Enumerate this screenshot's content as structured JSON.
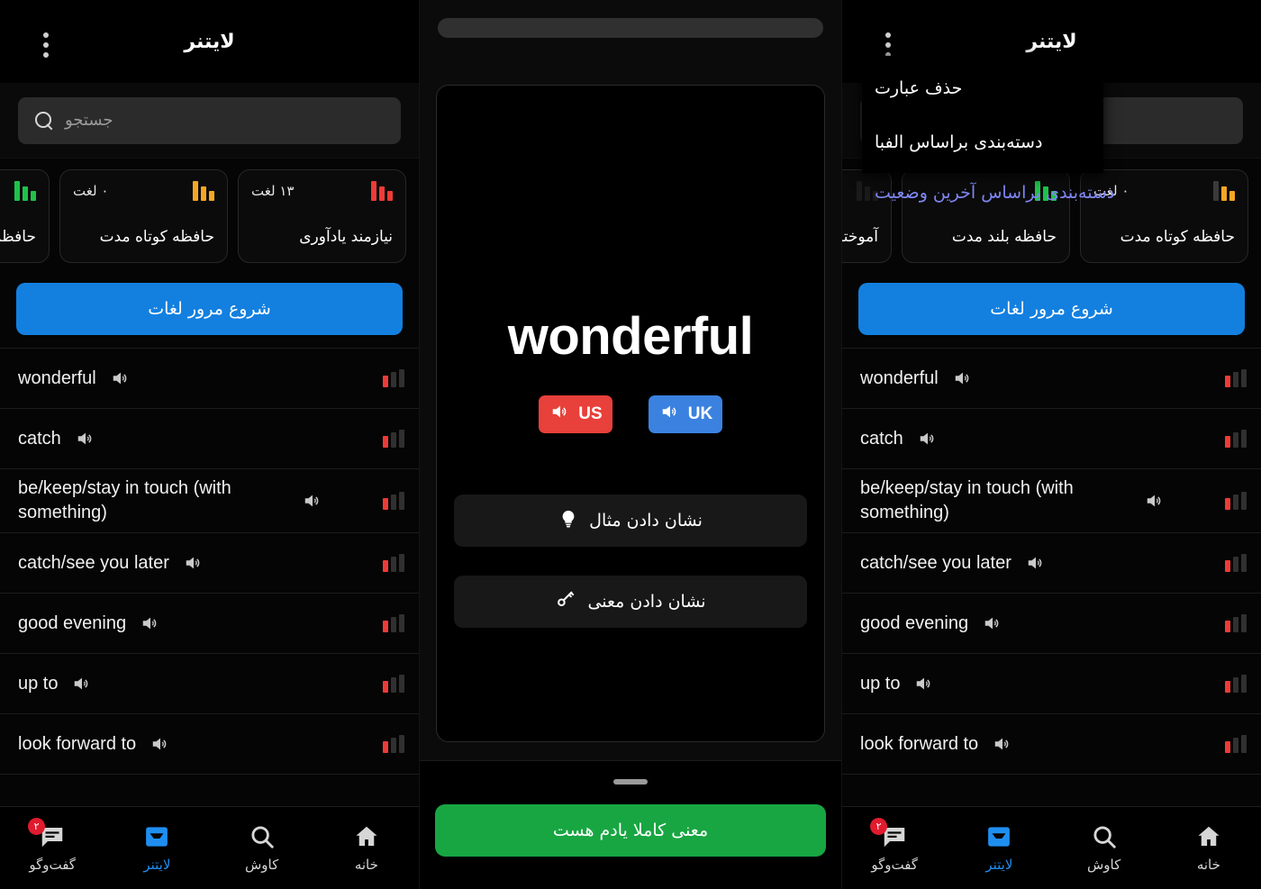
{
  "app": {
    "title": "لایتنر",
    "kebab_icon": "more-vertical-icon"
  },
  "search": {
    "placeholder": "جستجو",
    "value": "",
    "icon": "search-icon"
  },
  "menu": {
    "items": [
      {
        "label": "حذف عبارت",
        "highlight": false
      },
      {
        "label": "دسته‌بندی براساس الفبا",
        "highlight": false
      },
      {
        "label": "دسته‌بندی براساس آخرین وضعیت",
        "highlight": true
      }
    ]
  },
  "stats": {
    "cards": [
      {
        "label": "نیازمند یادآوری",
        "count": "۱۳ لغت",
        "color": "#ef3b36",
        "bars_icon": "bar-chart-icon"
      },
      {
        "label": "حافظه کوتاه مدت",
        "count": "۰ لغت",
        "color": "#f5a623",
        "bars_icon": "bar-chart-icon"
      },
      {
        "label": "حافظه بلند مدت",
        "count": "",
        "color": "#1fc24a",
        "bars_icon": "bar-chart-icon"
      },
      {
        "label": "آموخته شده",
        "count": "",
        "color": "#1fc24a",
        "bars_icon": "bar-chart-icon"
      }
    ]
  },
  "review": {
    "start_label": "شروع مرور لغات"
  },
  "words": {
    "speaker_icon": "speaker-icon",
    "level_icon": "level-bars-icon",
    "items": [
      {
        "text": "wonderful",
        "level": 1,
        "level_color": "#ef3b36"
      },
      {
        "text": "catch",
        "level": 1,
        "level_color": "#ef3b36"
      },
      {
        "text": "be/keep/stay in touch (with something)",
        "level": 1,
        "level_color": "#ef3b36"
      },
      {
        "text": "catch/see you later",
        "level": 1,
        "level_color": "#ef3b36"
      },
      {
        "text": "good evening",
        "level": 1,
        "level_color": "#ef3b36"
      },
      {
        "text": "up to",
        "level": 1,
        "level_color": "#ef3b36"
      },
      {
        "text": "look forward to",
        "level": 1,
        "level_color": "#ef3b36"
      }
    ]
  },
  "flashcard": {
    "word": "wonderful",
    "progress_percent": 0,
    "accents": [
      {
        "label": "UK",
        "color": "#3b82e0",
        "icon": "speaker-icon"
      },
      {
        "label": "US",
        "color": "#e8403a",
        "icon": "speaker-icon"
      }
    ],
    "actions": [
      {
        "label": "نشان دادن مثال",
        "icon": "lightbulb-icon"
      },
      {
        "label": "نشان دادن معنی",
        "icon": "key-icon"
      }
    ],
    "sheet": {
      "grabber": "drag-handle",
      "confirm_label": "معنی کاملا یادم هست",
      "confirm_color": "#18a642"
    }
  },
  "bottom_nav": {
    "items": [
      {
        "label": "خانه",
        "icon": "home-icon",
        "active": false,
        "badge": ""
      },
      {
        "label": "کاوش",
        "icon": "search-icon",
        "active": false,
        "badge": ""
      },
      {
        "label": "لایتنر",
        "icon": "inbox-icon",
        "active": true,
        "badge": ""
      },
      {
        "label": "گفت‌وگو",
        "icon": "chat-icon",
        "active": false,
        "badge": "۲"
      }
    ]
  },
  "colors": {
    "accent_blue": "#1380e0",
    "active_blue": "#1f8ef1",
    "green": "#18a642",
    "red": "#ef3b36",
    "orange": "#f5a623",
    "menu_highlight": "#7f86f2"
  }
}
